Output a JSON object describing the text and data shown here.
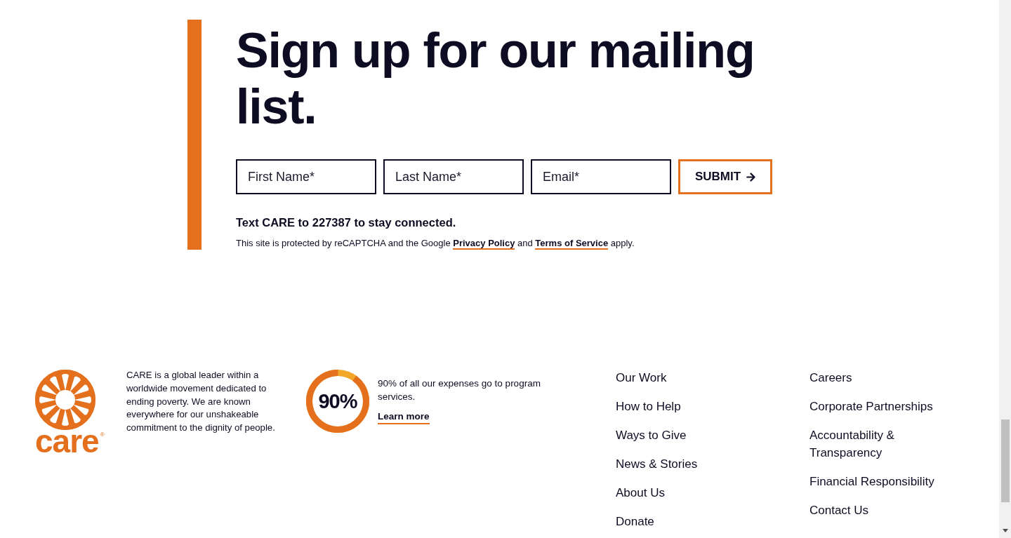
{
  "signup": {
    "heading": "Sign up for our mailing list.",
    "fields": [
      {
        "placeholder": "First Name*"
      },
      {
        "placeholder": "Last Name*"
      },
      {
        "placeholder": "Email*"
      }
    ],
    "submit_button": "SUBMIT",
    "text_prompt": "Text CARE to 227387 to stay connected.",
    "recaptcha_notice": [
      {
        "kind": "text",
        "text": "This site is protected by reCAPTCHA and the Google "
      },
      {
        "kind": "link",
        "text": "Privacy Policy"
      },
      {
        "kind": "text",
        "text": " and "
      },
      {
        "kind": "link",
        "text": "Terms of Service"
      },
      {
        "kind": "text",
        "text": " apply."
      }
    ]
  },
  "footer": {
    "logo": {
      "wordmark": "care",
      "mark": "®"
    },
    "about": "CARE is a global leader within a worldwide movement dedicated to ending poverty. We are known everywhere for our unshakeable commitment to the dignity of people.",
    "stat": {
      "value": "90%",
      "level": 0.9,
      "text": "90% of all our expenses go to program services.",
      "link": "Learn more"
    },
    "nav_columns": [
      [
        "Our Work",
        "How to Help",
        "Ways to Give",
        "News & Stories",
        "About Us",
        "Donate"
      ],
      [
        "Careers",
        "Corporate Partnerships",
        "Accountability & Transparency",
        "Financial Responsibility",
        "Contact Us"
      ]
    ]
  }
}
